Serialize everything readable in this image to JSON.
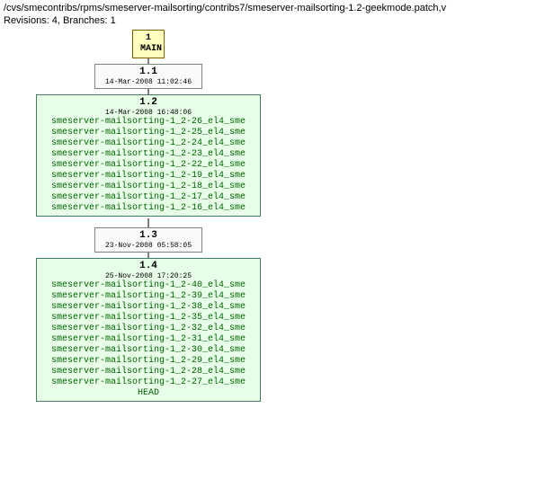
{
  "header": {
    "path": "/cvs/smecontribs/rpms/smeserver-mailsorting/contribs7/smeserver-mailsorting-1.2-geekmode.patch,v",
    "stats": "Revisions: 4, Branches: 1"
  },
  "main": {
    "num": "1",
    "label": "MAIN"
  },
  "rev11": {
    "num": "1.1",
    "date": "14-Mar-2008 11:02:46"
  },
  "rev12": {
    "num": "1.2",
    "date": "14-Mar-2008 16:48:06",
    "tags": [
      "smeserver-mailsorting-1_2-26_el4_sme",
      "smeserver-mailsorting-1_2-25_el4_sme",
      "smeserver-mailsorting-1_2-24_el4_sme",
      "smeserver-mailsorting-1_2-23_el4_sme",
      "smeserver-mailsorting-1_2-22_el4_sme",
      "smeserver-mailsorting-1_2-19_el4_sme",
      "smeserver-mailsorting-1_2-18_el4_sme",
      "smeserver-mailsorting-1_2-17_el4_sme",
      "smeserver-mailsorting-1_2-16_el4_sme"
    ]
  },
  "rev13": {
    "num": "1.3",
    "date": "23-Nov-2008 05:58:05"
  },
  "rev14": {
    "num": "1.4",
    "date": "25-Nov-2008 17:20:25",
    "tags": [
      "smeserver-mailsorting-1_2-40_el4_sme",
      "smeserver-mailsorting-1_2-39_el4_sme",
      "smeserver-mailsorting-1_2-38_el4_sme",
      "smeserver-mailsorting-1_2-35_el4_sme",
      "smeserver-mailsorting-1_2-32_el4_sme",
      "smeserver-mailsorting-1_2-31_el4_sme",
      "smeserver-mailsorting-1_2-30_el4_sme",
      "smeserver-mailsorting-1_2-29_el4_sme",
      "smeserver-mailsorting-1_2-28_el4_sme",
      "smeserver-mailsorting-1_2-27_el4_sme",
      "HEAD"
    ]
  }
}
